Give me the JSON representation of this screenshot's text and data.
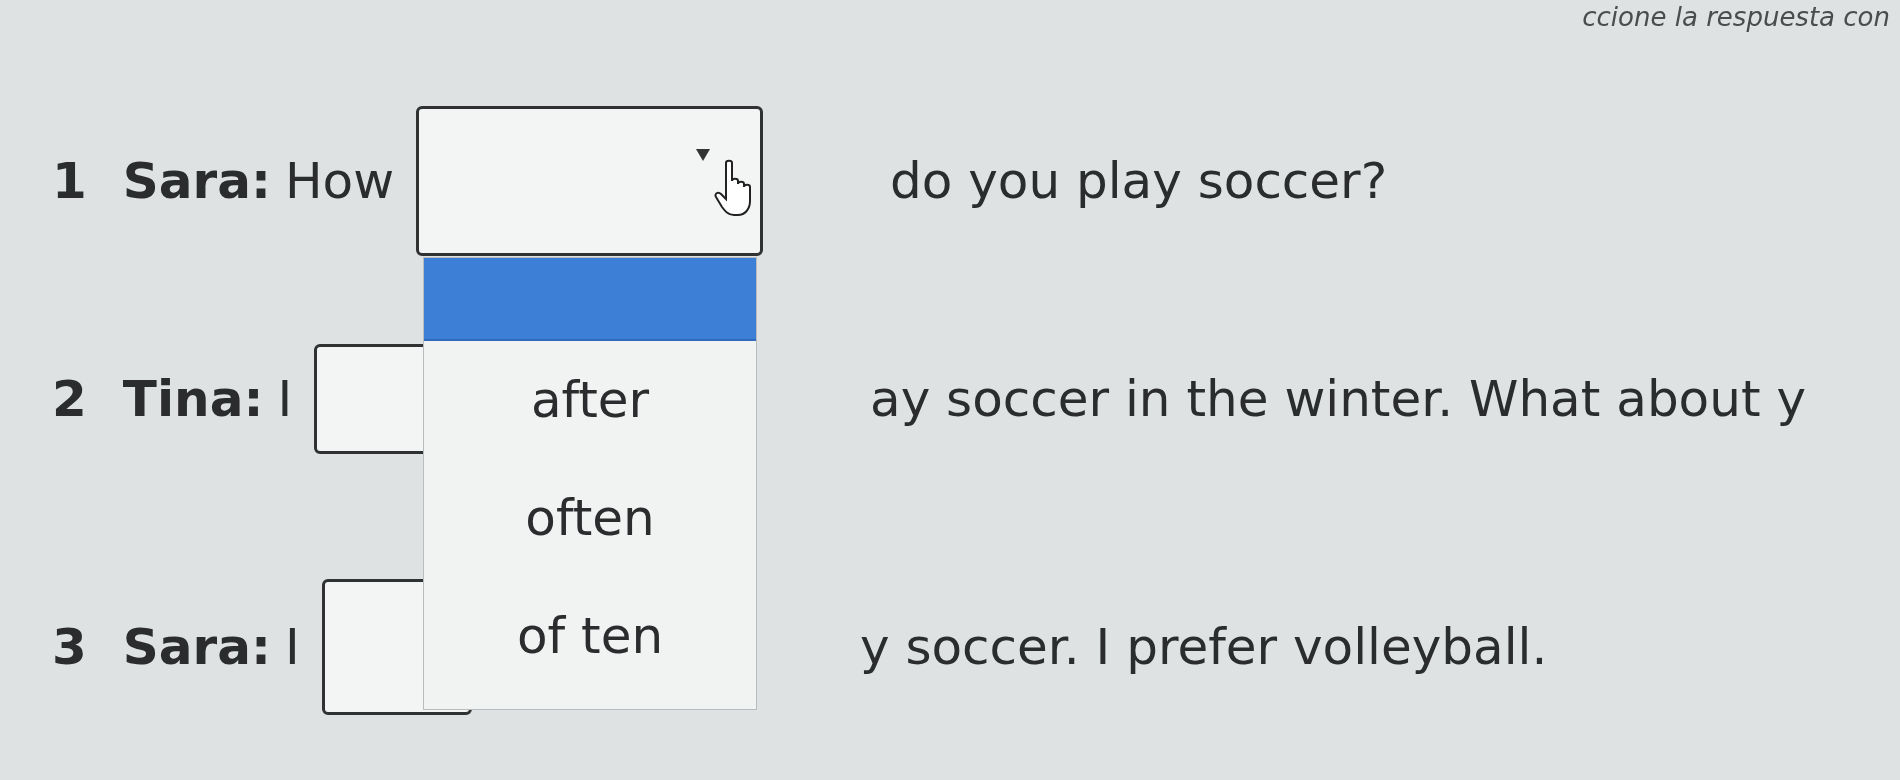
{
  "instruction": "ccione la respuesta con",
  "items": [
    {
      "number": "1",
      "speaker": "Sara:",
      "before": "How",
      "after": "do you play soccer?",
      "open": true
    },
    {
      "number": "2",
      "speaker": "Tina:",
      "before": "I",
      "after": "ay soccer in the winter. What about y",
      "open": false
    },
    {
      "number": "3",
      "speaker": "Sara:",
      "before": "I",
      "after": "y soccer. I prefer volleyball.",
      "open": false
    }
  ],
  "menu": {
    "options": [
      {
        "selected": true
      },
      {
        "label": "after",
        "selected": false
      },
      {
        "label": "often",
        "selected": false
      },
      {
        "label": "of ten",
        "selected": false
      }
    ]
  }
}
